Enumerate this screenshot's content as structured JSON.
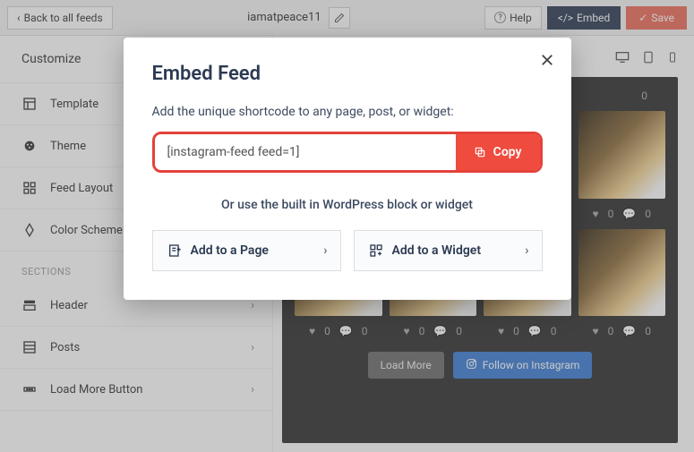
{
  "topbar": {
    "back_label": "Back to all feeds",
    "feed_name": "iamatpeace11",
    "help_label": "Help",
    "embed_label": "Embed",
    "save_label": "Save"
  },
  "sidebar": {
    "customize_label": "Customize",
    "items": [
      {
        "label": "Template",
        "icon": "template-icon"
      },
      {
        "label": "Theme",
        "icon": "theme-icon"
      },
      {
        "label": "Feed Layout",
        "icon": "layout-icon"
      },
      {
        "label": "Color Scheme",
        "icon": "color-icon"
      }
    ],
    "sections_label": "SECTIONS",
    "section_items": [
      {
        "label": "Header",
        "icon": "header-icon"
      },
      {
        "label": "Posts",
        "icon": "posts-icon"
      },
      {
        "label": "Load More Button",
        "icon": "loadmore-icon"
      }
    ]
  },
  "preview": {
    "top_count": "0",
    "tile_count": 8,
    "counts": [
      "0",
      "0",
      "0",
      "0",
      "0",
      "0",
      "0",
      "0"
    ],
    "loadmore_label": "Load More",
    "follow_label": "Follow on Instagram"
  },
  "modal": {
    "title": "Embed Feed",
    "subtitle": "Add the unique shortcode to any page, post, or widget:",
    "shortcode": "[instagram-feed feed=1]",
    "copy_label": "Copy",
    "or_text": "Or use the built in WordPress block or widget",
    "add_page_label": "Add to a Page",
    "add_widget_label": "Add to a Widget"
  }
}
